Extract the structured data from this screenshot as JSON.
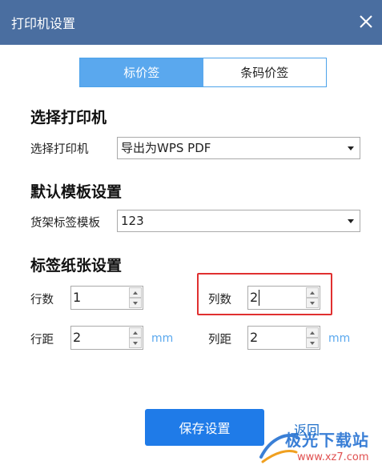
{
  "window": {
    "title": "打印机设置",
    "title_bar_color": "#4a6ea0"
  },
  "tabs": [
    {
      "label": "标价签",
      "active": true
    },
    {
      "label": "条码价签",
      "active": false
    }
  ],
  "printer_section": {
    "heading": "选择打印机",
    "label": "选择打印机",
    "selected": "导出为WPS PDF"
  },
  "template_section": {
    "heading": "默认模板设置",
    "label": "货架标签模板",
    "selected": "123"
  },
  "paper_section": {
    "heading": "标签纸张设置",
    "rows_label": "行数",
    "rows_value": "1",
    "cols_label": "列数",
    "cols_value": "2",
    "row_gap_label": "行距",
    "row_gap_value": "2",
    "row_gap_unit": "mm",
    "col_gap_label": "列距",
    "col_gap_value": "2",
    "col_gap_unit": "mm"
  },
  "actions": {
    "save_label": "保存设置",
    "back_label": "返回"
  },
  "watermark": {
    "name": "极光下载站",
    "url": "www.xz7.com"
  },
  "colors": {
    "accent": "#5aa8ee",
    "primary_button": "#1f7be8",
    "highlight_box": "#e03030"
  },
  "icons": {
    "close": "close-icon",
    "dropdown": "chevron-down-icon",
    "spinner": "spinner-arrows-icon"
  }
}
